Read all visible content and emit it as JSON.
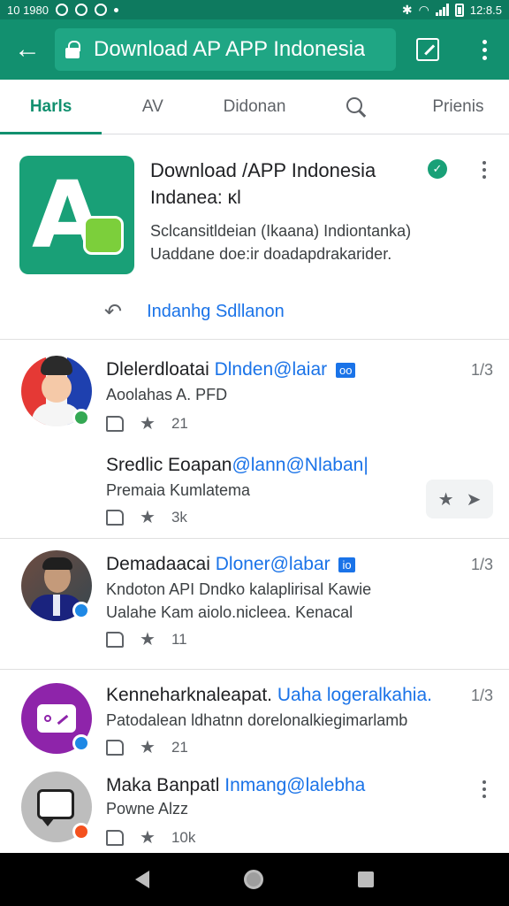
{
  "status_bar": {
    "time_left": "10 1980",
    "time_right": "12:8.5"
  },
  "app_bar": {
    "url": "Download AP APP Indonesia"
  },
  "tabs": [
    {
      "label": "Harls",
      "active": true
    },
    {
      "label": "AV",
      "active": false
    },
    {
      "label": "Didonan",
      "active": false
    },
    {
      "label": "",
      "icon": "search-icon",
      "active": false
    },
    {
      "label": "Prienis",
      "active": false
    }
  ],
  "app_card": {
    "logo_letter": "A",
    "title": "Download /APP Indonesia",
    "subtitle": "Indanea: ĸl",
    "desc_line1": "Sclcansitldeian (Ikaana) Indiontanka)",
    "desc_line2": "Uaddane doe:ir doadapdrakarider.",
    "share_label": "Indanhg Sdllanon",
    "colors": {
      "logo_bg": "#19a077",
      "accent": "#12906f",
      "link": "#1a73e8"
    }
  },
  "posts": [
    {
      "author": "Dlelerdloatai",
      "handle": "Dlnden@laiar",
      "tag": "oo",
      "time": "1/3",
      "line1": "Aoolahas A. PFD",
      "line2": "",
      "likes_icon": "thumbs-up-icon",
      "stars": "21",
      "avatar_colors": [
        "#e53935",
        "#1e40af",
        "#f5c9a8"
      ],
      "badge_color": "#34a853"
    },
    {
      "author": "Sredlic Eoapan",
      "handle": "@lann@Nlaban|",
      "tag": "",
      "time": "",
      "line1": "Premaia Kumlatema",
      "line2": "",
      "stars": "3k"
    },
    {
      "author": "Demadaacai",
      "handle": "Dloner@labar",
      "tag": "io",
      "time": "1/3",
      "line1": "Kndoton API Dndko kalaplirisal Kawie",
      "line2": "Ualahe Kam aiolo.nicleea. Kenacal",
      "stars": "11",
      "avatar_colors": [
        "#5d4037",
        "#1a237e",
        "#c49a7a"
      ],
      "badge_color": "#1e88e5"
    },
    {
      "author": "Kenneharknaleapat.",
      "handle": "Uaha logeralkahia.",
      "tag": "",
      "time": "1/3",
      "line1": "Patodalean ldhatnn dorelonalkiegimarlamb",
      "line2": "",
      "stars": "21",
      "avatar_colors": [
        "#8e24aa"
      ],
      "badge_color": "#1e88e5"
    },
    {
      "author": "Maka Banpatl",
      "handle": "Inmang@lalebha",
      "tag": "",
      "time": "",
      "line1": "Powne Alzz",
      "line2": "",
      "stars": "10k",
      "avatar_colors": [
        "#9e9e9e"
      ],
      "badge_color": "#f4511e"
    }
  ]
}
